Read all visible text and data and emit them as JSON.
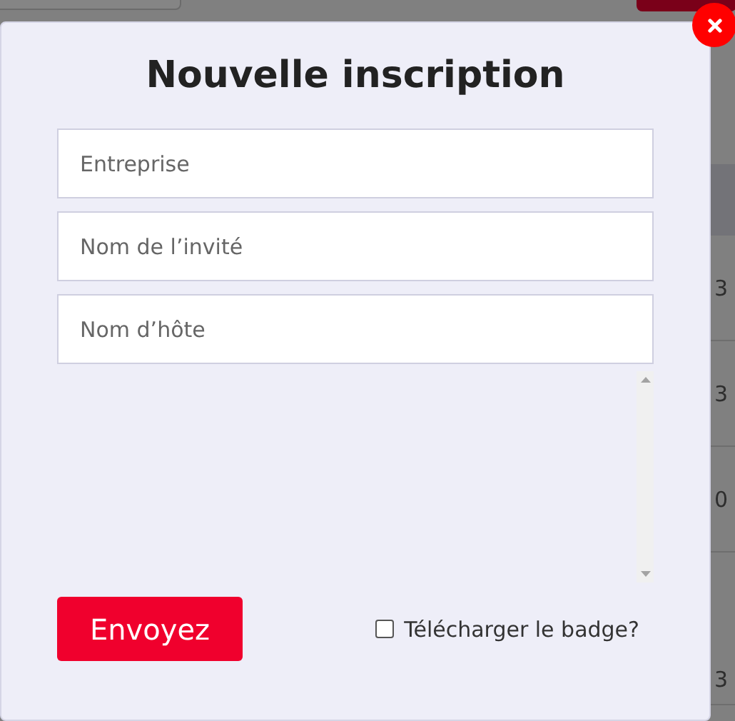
{
  "background": {
    "column_cells": [
      "3",
      "3",
      "0",
      "3"
    ]
  },
  "dialog": {
    "title": "Nouvelle inscription",
    "fields": [
      {
        "placeholder": "Entreprise"
      },
      {
        "placeholder": "Nom de l’invité"
      },
      {
        "placeholder": "Nom d’hôte"
      }
    ],
    "submit": "Envoyez",
    "badge_option": {
      "label": "Télécharger le badge?",
      "checked": false
    }
  }
}
